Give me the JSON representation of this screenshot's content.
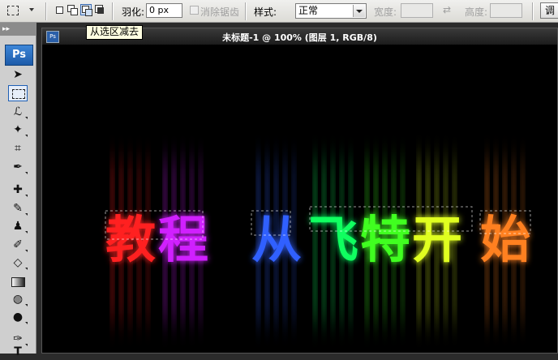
{
  "options": {
    "feather_label": "羽化:",
    "feather_value": "0 px",
    "antialias_label": "消除锯齿",
    "style_label": "样式:",
    "style_value": "正常",
    "width_label": "宽度:",
    "height_label": "高度:",
    "adjust_label": "调"
  },
  "tooltip": "从选区减去",
  "toolbox": {
    "grip": "▸▸",
    "logo": "Ps"
  },
  "document": {
    "title": "未标题-1 @ 100% (图层 1, RGB/8)",
    "icon_label": "Ps"
  },
  "canvas_text": {
    "chars": [
      "教",
      "程",
      "从",
      "飞",
      "特",
      "开",
      "始"
    ],
    "colors": [
      "#ff2020",
      "#d020ff",
      "#3060ff",
      "#10ff60",
      "#40ff20",
      "#e0ff20",
      "#ff8020"
    ],
    "background": "#000000"
  }
}
